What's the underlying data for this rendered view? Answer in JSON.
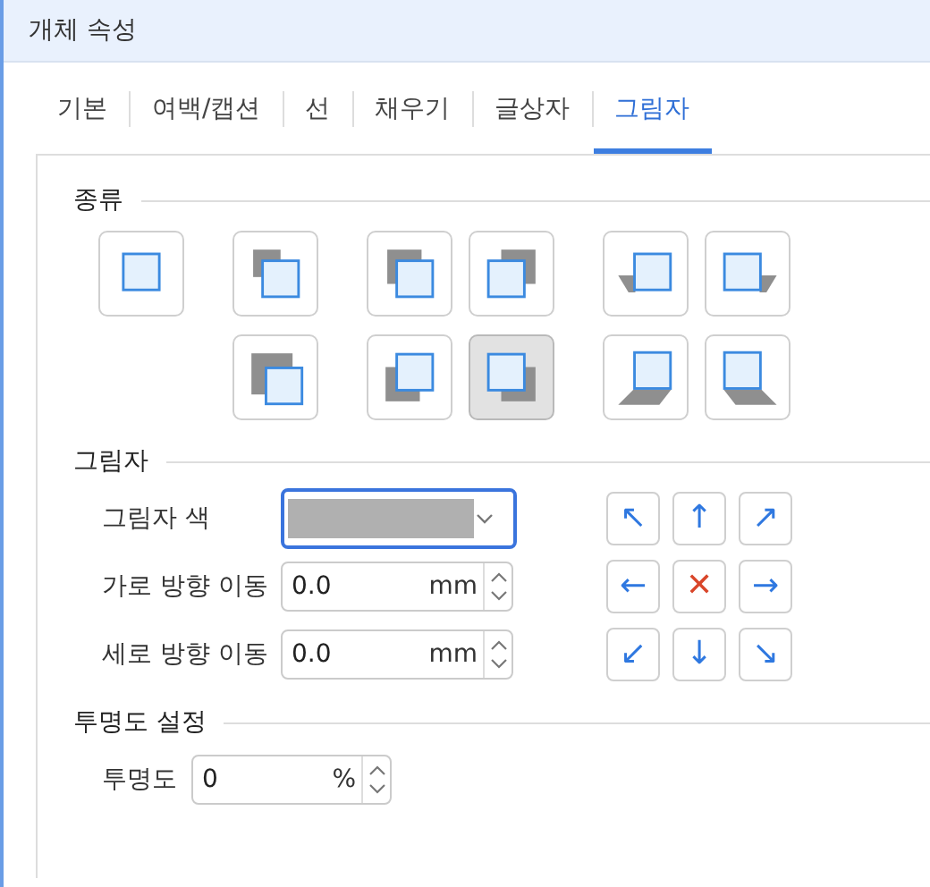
{
  "window": {
    "title": "개체 속성"
  },
  "tabs": [
    {
      "label": "기본",
      "selected": false
    },
    {
      "label": "여백/캡션",
      "selected": false
    },
    {
      "label": "선",
      "selected": false
    },
    {
      "label": "채우기",
      "selected": false
    },
    {
      "label": "글상자",
      "selected": false
    },
    {
      "label": "그림자",
      "selected": true
    }
  ],
  "type_section": {
    "title": "종류",
    "types": [
      {
        "kind": "none",
        "selected": false
      },
      {
        "kind": "small-up-left",
        "selected": false
      },
      {
        "kind": "up-left",
        "selected": false
      },
      {
        "kind": "up-right",
        "selected": false
      },
      {
        "kind": "skew-left",
        "selected": false
      },
      {
        "kind": "skew-right",
        "selected": false
      },
      {
        "kind": "large-up-left",
        "selected": false
      },
      {
        "kind": "down-left",
        "selected": false
      },
      {
        "kind": "down-right",
        "selected": true
      },
      {
        "kind": "floor-left",
        "selected": false
      },
      {
        "kind": "floor-right",
        "selected": false
      }
    ]
  },
  "shadow_section": {
    "title": "그림자",
    "color_label": "그림자 색",
    "color": "#b0b0b0",
    "offsets": [
      {
        "label": "가로 방향 이동",
        "value": "0.0",
        "unit": "mm"
      },
      {
        "label": "세로 방향 이동",
        "value": "0.0",
        "unit": "mm"
      }
    ],
    "direction_buttons": [
      {
        "kind": "arrow",
        "glyph": "↖"
      },
      {
        "kind": "arrow",
        "glyph": "↑"
      },
      {
        "kind": "arrow",
        "glyph": "↗"
      },
      {
        "kind": "arrow",
        "glyph": "←"
      },
      {
        "kind": "clear",
        "glyph": "✕"
      },
      {
        "kind": "arrow",
        "glyph": "→"
      },
      {
        "kind": "arrow",
        "glyph": "↙"
      },
      {
        "kind": "arrow",
        "glyph": "↓"
      },
      {
        "kind": "arrow",
        "glyph": "↘"
      }
    ]
  },
  "transparency_section": {
    "title": "투명도 설정",
    "label": "투명도",
    "value": "0",
    "unit": "%"
  }
}
